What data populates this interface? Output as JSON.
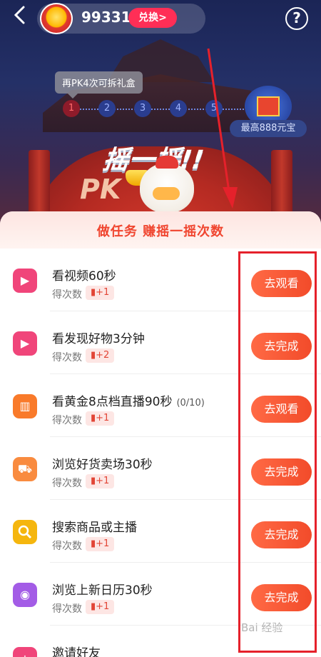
{
  "header": {
    "back_icon": "chevron-left-icon",
    "coin_icon": "gold-ingot-icon",
    "coin_value": "99331",
    "exchange_label": "兑换>",
    "help_label": "?"
  },
  "banner": {
    "tooltip": "再PK4次可拆礼盒",
    "steps": [
      "1",
      "2",
      "3",
      "4",
      "5"
    ],
    "active_step": 1,
    "gift_caption": "最高888元宝",
    "shake_title": "摇一摇!!",
    "pk_text": "PK"
  },
  "sheet": {
    "title": "做任务 赚摇一摇次数",
    "reward_prefix": "得次数",
    "tasks": [
      {
        "title": "看视频60秒",
        "progress": "",
        "reward": "+1",
        "button": "去观看",
        "icon": "video-icon",
        "color": "#f0457a"
      },
      {
        "title": "看发现好物3分钟",
        "progress": "",
        "reward": "+2",
        "button": "去完成",
        "icon": "video-icon",
        "color": "#f0457a"
      },
      {
        "title": "看黄金8点档直播90秒",
        "progress": "(0/10)",
        "reward": "+1",
        "button": "去观看",
        "icon": "tv-icon",
        "color": "#f97a2a"
      },
      {
        "title": "浏览好货卖场30秒",
        "progress": "",
        "reward": "+1",
        "button": "去完成",
        "icon": "cart-icon",
        "color": "#f98b3f"
      },
      {
        "title": "搜索商品或主播",
        "progress": "",
        "reward": "+1",
        "button": "去完成",
        "icon": "search-icon",
        "color": "#f5b60e"
      },
      {
        "title": "浏览上新日历30秒",
        "progress": "",
        "reward": "+1",
        "button": "去完成",
        "icon": "eye-icon",
        "color": "#a35ce6"
      },
      {
        "title": "邀请好友",
        "progress": "",
        "reward": "",
        "button": "",
        "icon": "invite-icon",
        "color": "#f0457a"
      }
    ]
  },
  "watermark": "Bai 经验"
}
